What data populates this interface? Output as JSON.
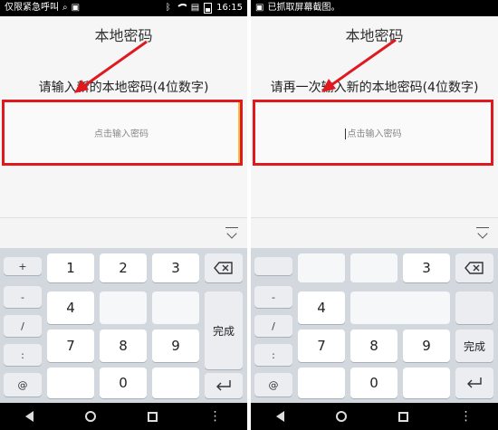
{
  "left": {
    "status_left_text": "仅限紧急呼叫",
    "status_time": "16:15",
    "title": "本地密码",
    "prompt": "请输入新的本地密码(4位数字)",
    "placeholder": "点击输入密码",
    "keys": {
      "sym1": "+",
      "sym2": "-",
      "sym3": "/",
      "sym4": ":",
      "sym5": "@",
      "k1": "1",
      "k2": "2",
      "k3": "3",
      "k4": "4",
      "k7": "7",
      "k8": "8",
      "k9": "9",
      "k0": "0",
      "done": "完成"
    }
  },
  "right": {
    "status_left_text": "已抓取屏幕截图。",
    "title": "本地密码",
    "prompt": "请再一次输入新的本地密码(4位数字)",
    "placeholder": "点击输入密码",
    "keys": {
      "sym1": "",
      "sym2": "-",
      "sym3": "/",
      "sym4": ":",
      "sym5": "@",
      "k3": "3",
      "k4": "4",
      "k7": "7",
      "k8": "8",
      "k9": "9",
      "k0": "0",
      "done": "完成"
    }
  },
  "icons": {
    "delete": "delete-icon",
    "enter": "enter-icon",
    "collapse": "keyboard-collapse-icon",
    "arrow_color": "#e0191f",
    "highlight_color": "#e0191f"
  }
}
